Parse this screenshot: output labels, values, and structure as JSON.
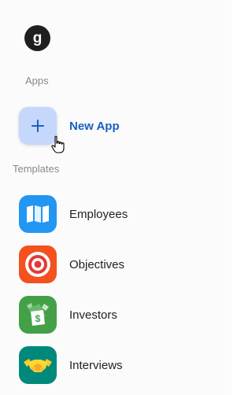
{
  "brand": {
    "logo_letter": "g"
  },
  "sections": {
    "apps_label": "Apps",
    "templates_label": "Templates"
  },
  "new_app": {
    "label": "New App",
    "icon": "plus-icon",
    "tile_color": "#c5d7fb",
    "label_color": "#1a5fc1"
  },
  "templates": [
    {
      "label": "Employees",
      "icon": "map-icon",
      "color": "#2196f3"
    },
    {
      "label": "Objectives",
      "icon": "target-icon",
      "color": "#f4511e"
    },
    {
      "label": "Investors",
      "icon": "money-icon",
      "color": "#43a047"
    },
    {
      "label": "Interviews",
      "icon": "handshake-icon",
      "color": "#00897b"
    }
  ]
}
